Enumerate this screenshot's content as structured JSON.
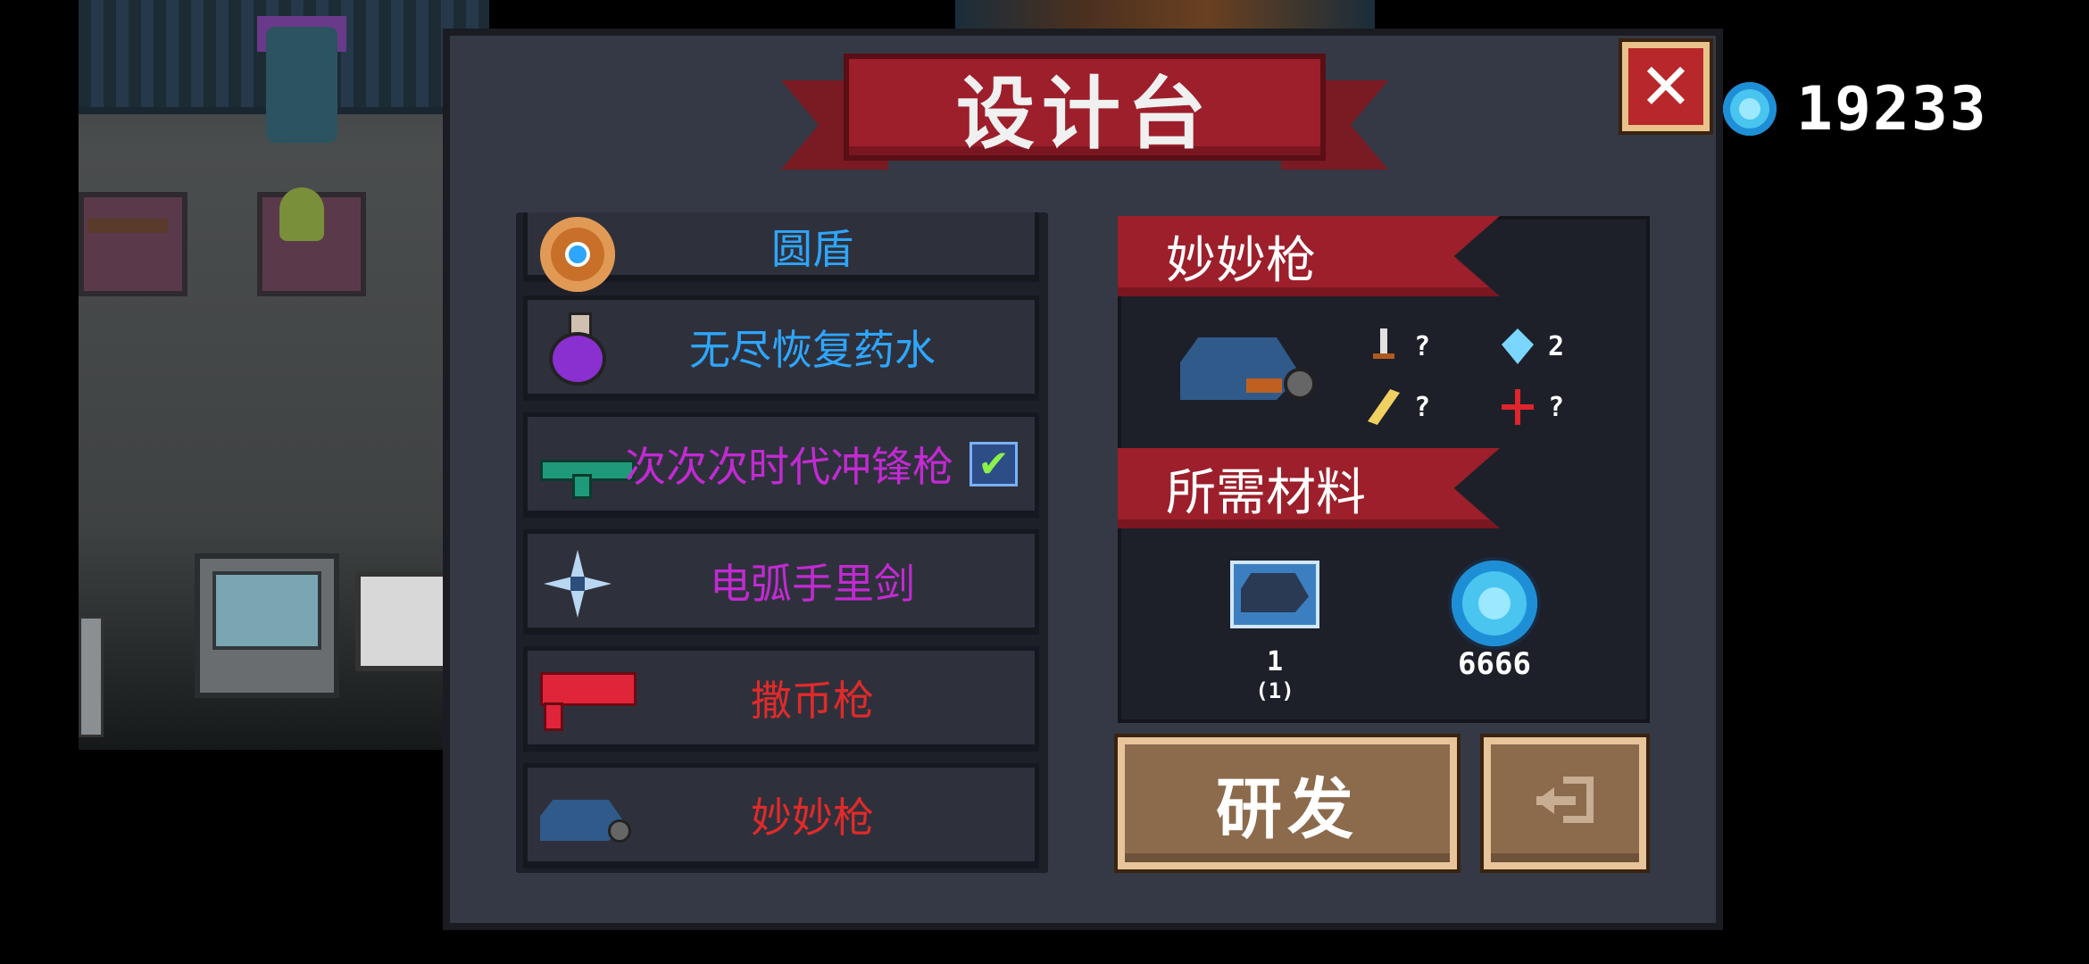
{
  "title": "设计台",
  "currency": {
    "amount": "19233",
    "icon": "gem-coin-icon"
  },
  "close": {
    "icon": "close-icon",
    "label": "✕"
  },
  "items": [
    {
      "name": "圆盾",
      "color": "#2ea6ff",
      "icon": "round-shield-icon"
    },
    {
      "name": "无尽恢复药水",
      "color": "#2ea6ff",
      "icon": "potion-icon"
    },
    {
      "name": "次次次时代冲锋枪",
      "color": "#c22ad2",
      "icon": "smg-icon",
      "checked": true
    },
    {
      "name": "电弧手里剑",
      "color": "#c22ad2",
      "icon": "shuriken-icon"
    },
    {
      "name": "撒币枪",
      "color": "#e12a2a",
      "icon": "coin-gun-icon"
    },
    {
      "name": "妙妙枪",
      "color": "#e12a2a",
      "icon": "cat-gun-icon"
    }
  ],
  "check_mark": "✔",
  "detail": {
    "weapon_name": "妙妙枪",
    "stats": {
      "damage": "?",
      "energy": "2",
      "crit": "?",
      "accuracy": "?"
    },
    "materials_title": "所需材料",
    "materials": [
      {
        "icon": "cat-gun-blueprint-icon",
        "count": "1",
        "owned": "(1)"
      },
      {
        "icon": "gem-coin-icon",
        "count": "6666"
      }
    ]
  },
  "buttons": {
    "research": "研发",
    "exit_icon": "exit-icon"
  }
}
